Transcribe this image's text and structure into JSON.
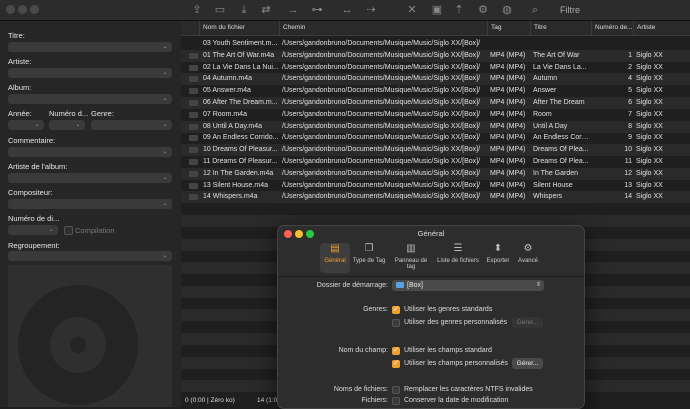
{
  "toolbar": {
    "search_label": "Filtre"
  },
  "sidebar": {
    "fields": {
      "titre": "Titre:",
      "artiste": "Artiste:",
      "album": "Album:",
      "annee": "Année:",
      "numero": "Numéro d...",
      "genre": "Genre:",
      "commentaire": "Commentaire:",
      "artiste_album": "Artiste de l'album:",
      "compositeur": "Compositeur:",
      "numero_disque": "Numéro de di...",
      "compilation": "Compilation",
      "regroupement": "Regroupement:"
    }
  },
  "list": {
    "columns": [
      "Nom du fichier",
      "Chemin",
      "Tag",
      "Titre",
      "Numéro de...",
      "Artiste"
    ],
    "rows": [
      {
        "file": "03 Youth Sentiment.m...",
        "path": "/Users/gandonbruno/Documents/Musique/Music/Siglo XX/[Box]/",
        "tag": "",
        "title": "",
        "num": "",
        "artist": ""
      },
      {
        "file": "01 The Art Of War.m4a",
        "path": "/Users/gandonbruno/Documents/Musique/Music/Siglo XX/[Box]/",
        "tag": "MP4 (MP4)",
        "title": "The Art Of War",
        "num": "1",
        "artist": "Siglo XX"
      },
      {
        "file": "02 La Vie Dans La Nui...",
        "path": "/Users/gandonbruno/Documents/Musique/Music/Siglo XX/[Box]/",
        "tag": "MP4 (MP4)",
        "title": "La Vie Dans La...",
        "num": "2",
        "artist": "Siglo XX"
      },
      {
        "file": "04 Autumn.m4a",
        "path": "/Users/gandonbruno/Documents/Musique/Music/Siglo XX/[Box]/",
        "tag": "MP4 (MP4)",
        "title": "Autumn",
        "num": "4",
        "artist": "Siglo XX"
      },
      {
        "file": "05 Answer.m4a",
        "path": "/Users/gandonbruno/Documents/Musique/Music/Siglo XX/[Box]/",
        "tag": "MP4 (MP4)",
        "title": "Answer",
        "num": "5",
        "artist": "Siglo XX"
      },
      {
        "file": "06 After The Dream.m...",
        "path": "/Users/gandonbruno/Documents/Musique/Music/Siglo XX/[Box]/",
        "tag": "MP4 (MP4)",
        "title": "After The Dream",
        "num": "6",
        "artist": "Siglo XX"
      },
      {
        "file": "07 Room.m4a",
        "path": "/Users/gandonbruno/Documents/Musique/Music/Siglo XX/[Box]/",
        "tag": "MP4 (MP4)",
        "title": "Room",
        "num": "7",
        "artist": "Siglo XX"
      },
      {
        "file": "08 Until A Day.m4a",
        "path": "/Users/gandonbruno/Documents/Musique/Music/Siglo XX/[Box]/",
        "tag": "MP4 (MP4)",
        "title": "Until A Day",
        "num": "8",
        "artist": "Siglo XX"
      },
      {
        "file": "09 An Endless Corrido...",
        "path": "/Users/gandonbruno/Documents/Musique/Music/Siglo XX/[Box]/",
        "tag": "MP4 (MP4)",
        "title": "An Endless Corr...",
        "num": "9",
        "artist": "Siglo XX"
      },
      {
        "file": "10 Dreams Of Pleasur...",
        "path": "/Users/gandonbruno/Documents/Musique/Music/Siglo XX/[Box]/",
        "tag": "MP4 (MP4)",
        "title": "Dreams Of Plea...",
        "num": "10",
        "artist": "Siglo XX"
      },
      {
        "file": "11 Dreams Of Pleasur...",
        "path": "/Users/gandonbruno/Documents/Musique/Music/Siglo XX/[Box]/",
        "tag": "MP4 (MP4)",
        "title": "Dreams Of Plea...",
        "num": "11",
        "artist": "Siglo XX"
      },
      {
        "file": "12 In The Garden.m4a",
        "path": "/Users/gandonbruno/Documents/Musique/Music/Siglo XX/[Box]/",
        "tag": "MP4 (MP4)",
        "title": "In The Garden",
        "num": "12",
        "artist": "Siglo XX"
      },
      {
        "file": "13 Silent House.m4a",
        "path": "/Users/gandonbruno/Documents/Musique/Music/Siglo XX/[Box]/",
        "tag": "MP4 (MP4)",
        "title": "Silent House",
        "num": "13",
        "artist": "Siglo XX"
      },
      {
        "file": "14 Whispers.m4a",
        "path": "/Users/gandonbruno/Documents/Musique/Music/Siglo XX/[Box]/",
        "tag": "MP4 (MP4)",
        "title": "Whispers",
        "num": "14",
        "artist": "Siglo XX"
      }
    ],
    "status_left": "0 (0:00 | Zéro ko)",
    "status_right": "14 (1:0..."
  },
  "dialog": {
    "title": "Général",
    "tabs": [
      "Général",
      "Type de Tag",
      "Panneau de tag",
      "Liste de fichiers",
      "Exporter",
      "Avancé"
    ],
    "dossier_label": "Dossier de démarrage:",
    "dossier_value": "[Box]",
    "genres_label": "Genres:",
    "genres_std": "Utiliser les genres standards",
    "genres_custom": "Utiliser des genres personnalisés",
    "gerer": "Gérer...",
    "nomchamp_label": "Nom du champ:",
    "champs_std": "Utiliser les champs standard",
    "champs_custom": "Utiliser les champs personnalisés",
    "gerer2": "Gérer...",
    "noms_fichiers_label": "Noms de fichiers:",
    "ntfs": "Remplacer les caractères NTFS invalides",
    "fichiers_label": "Fichiers:",
    "conserver_date": "Conserver la date de modification"
  },
  "colors": {
    "accent": "#f0a030",
    "close": "#ff5f57",
    "minimize": "#febc2e",
    "zoom": "#28c840"
  }
}
